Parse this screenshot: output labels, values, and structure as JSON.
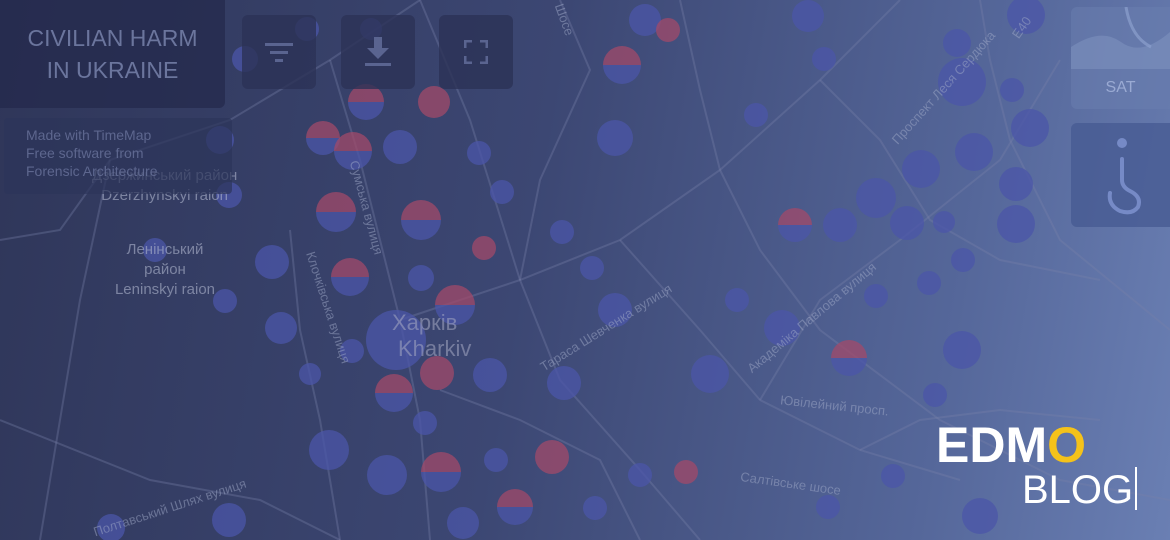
{
  "app": {
    "title_line1": "CIVILIAN HARM",
    "title_line2": "IN UKRAINE",
    "credit_line1": "Made with TimeMap",
    "credit_line2": "Free software from",
    "credit_line3": "Forensic Architecture"
  },
  "toolbar": {
    "filter_icon": "filter-icon",
    "download_icon": "download-icon",
    "fullscreen_icon": "fullscreen-icon"
  },
  "right_controls": {
    "sat_label": "SAT",
    "help_icon": "question-mark-icon"
  },
  "map": {
    "city_uk": "Харків",
    "city_en": "Kharkiv",
    "districts": [
      {
        "uk": "Дзержинський район",
        "en": "Dzerzhynskyi raion"
      },
      {
        "uk": "Ленінський район",
        "en": "Leninskyi raion"
      }
    ],
    "streets": [
      "Клочківська вулиця",
      "Полтавський Шлях вулиця",
      "Тараса Шевченка вулиця",
      "Академіка Павлова вулиця",
      "Ювілейний просп.",
      "Салтівське шосе",
      "Шосе",
      "Сумська вулиця",
      "Проспект Леся Сердюка",
      "Е40"
    ],
    "colors": {
      "marker_blue": "#4b55a8",
      "marker_red": "#a14a6a",
      "overlay": "#3a4468"
    }
  },
  "branding": {
    "logo_word": "EDMO",
    "logo_sub": "BLOG",
    "accent": "#f4c21a"
  }
}
